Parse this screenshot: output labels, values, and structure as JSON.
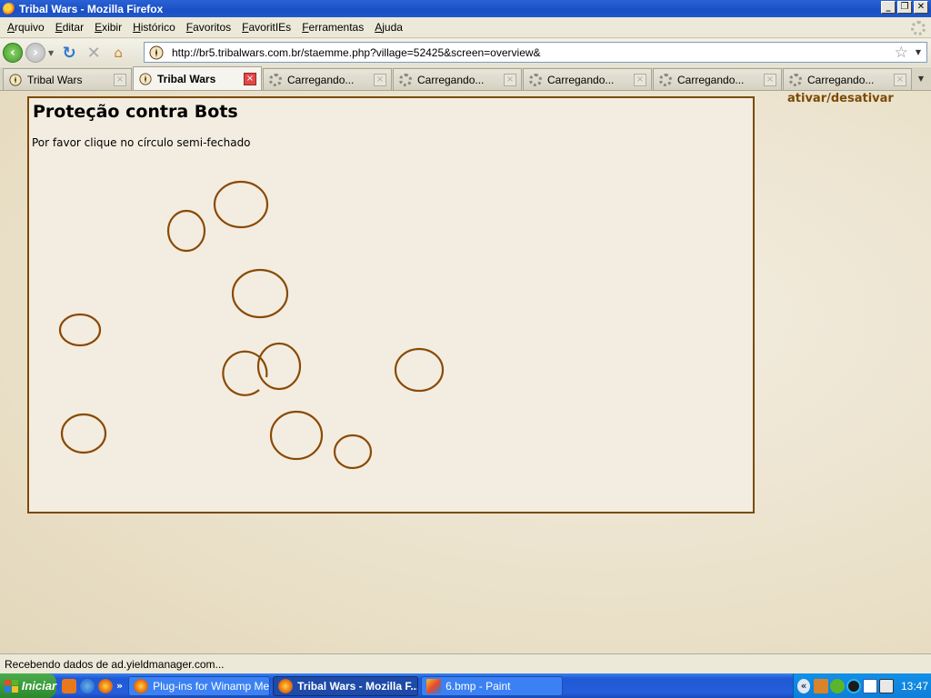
{
  "window": {
    "title": "Tribal Wars - Mozilla Firefox",
    "controls": [
      "_",
      "❐",
      "✕"
    ]
  },
  "menu": [
    "Arquivo",
    "Editar",
    "Exibir",
    "Histórico",
    "Favoritos",
    "FavoritIEs",
    "Ferramentas",
    "Ajuda"
  ],
  "navbar": {
    "url": "http://br5.tribalwars.com.br/staemme.php?village=52425&screen=overview&"
  },
  "tabs": [
    {
      "label": "Tribal Wars",
      "loading": false,
      "active": false
    },
    {
      "label": "Tribal Wars",
      "loading": false,
      "active": true
    },
    {
      "label": "Carregando...",
      "loading": true,
      "active": false
    },
    {
      "label": "Carregando...",
      "loading": true,
      "active": false
    },
    {
      "label": "Carregando...",
      "loading": true,
      "active": false
    },
    {
      "label": "Carregando...",
      "loading": true,
      "active": false
    },
    {
      "label": "Carregando...",
      "loading": true,
      "active": false
    }
  ],
  "page": {
    "toggle_link": "ativar/desativar",
    "title": "Proteção contra Bots",
    "instruction": "Por favor clique no círculo semi-fechado",
    "accent_color": "#7b4a05"
  },
  "status": {
    "text": "Recebendo dados de ad.yieldmanager.com..."
  },
  "taskbar": {
    "start_label": "Iniciar",
    "tasks": [
      {
        "label": "Plug-ins for Winamp Medi...",
        "active": false
      },
      {
        "label": "Tribal Wars - Mozilla F...",
        "active": true
      },
      {
        "label": "6.bmp - Paint",
        "active": false
      }
    ],
    "clock": "13:47"
  }
}
